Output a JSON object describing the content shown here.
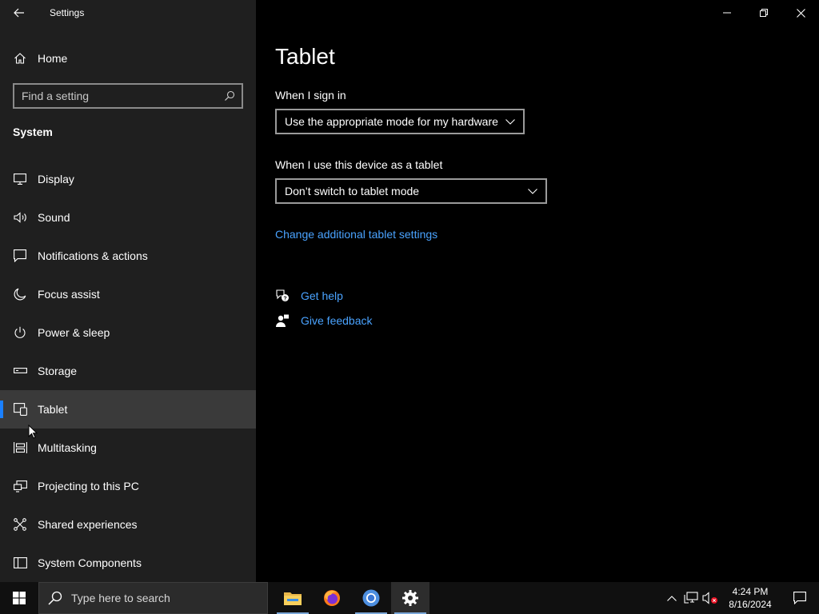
{
  "app": {
    "title": "Settings"
  },
  "sidebar": {
    "home_label": "Home",
    "search_placeholder": "Find a setting",
    "section_title": "System",
    "items": [
      {
        "label": "Display",
        "icon": "monitor-icon"
      },
      {
        "label": "Sound",
        "icon": "speaker-icon"
      },
      {
        "label": "Notifications & actions",
        "icon": "message-icon"
      },
      {
        "label": "Focus assist",
        "icon": "moon-icon"
      },
      {
        "label": "Power & sleep",
        "icon": "power-icon"
      },
      {
        "label": "Storage",
        "icon": "drive-icon"
      },
      {
        "label": "Tablet",
        "icon": "tablet-icon",
        "active": true
      },
      {
        "label": "Multitasking",
        "icon": "multitasking-icon"
      },
      {
        "label": "Projecting to this PC",
        "icon": "project-icon"
      },
      {
        "label": "Shared experiences",
        "icon": "shared-icon"
      },
      {
        "label": "System Components",
        "icon": "components-icon"
      }
    ]
  },
  "main": {
    "title": "Tablet",
    "sign_in": {
      "label": "When I sign in",
      "value": "Use the appropriate mode for my hardware"
    },
    "tablet_use": {
      "label": "When I use this device as a tablet",
      "value": "Don’t switch to tablet mode"
    },
    "additional_link": "Change additional tablet settings",
    "help": {
      "get_help": "Get help",
      "give_feedback": "Give feedback"
    }
  },
  "taskbar": {
    "search_placeholder": "Type here to search",
    "apps": [
      "file-explorer-icon",
      "firefox-icon",
      "chromium-icon",
      "settings-icon"
    ],
    "time": "4:24 PM",
    "date": "8/16/2024"
  },
  "colors": {
    "accent": "#1a80ff",
    "link": "#4aa3ff",
    "sidebar_bg": "#1f1f1f",
    "main_bg": "#000000"
  }
}
